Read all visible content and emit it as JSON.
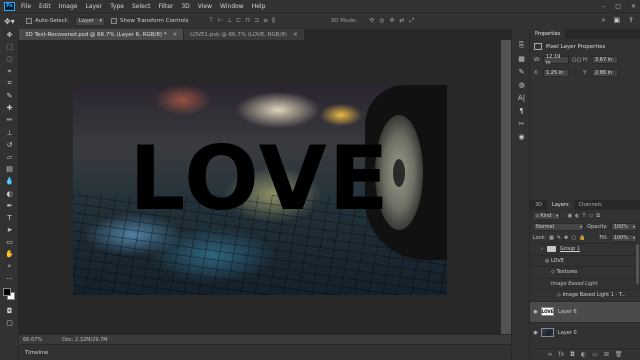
{
  "menu": {
    "logo": "Ps",
    "items": [
      "File",
      "Edit",
      "Image",
      "Layer",
      "Type",
      "Select",
      "Filter",
      "3D",
      "View",
      "Window",
      "Help"
    ],
    "window_controls": [
      "–",
      "□",
      "✕"
    ]
  },
  "options_bar": {
    "tool_icon": "move-icon",
    "auto_select_label": "Auto-Select:",
    "auto_select_value": "Layer",
    "show_transform_label": "Show Transform Controls",
    "mode_3d_label": "3D Mode:"
  },
  "tabs": [
    {
      "label": "3D Text-Recovered.psd @ 66.7% (Layer 6, RGB/8) *",
      "active": true
    },
    {
      "label": "LOVE1.psb @ 66.7% (LOVE, RGB/8)",
      "active": false
    }
  ],
  "canvas": {
    "artwork_text": "LOVE"
  },
  "status": {
    "zoom": "66.67%",
    "doc_info": "Doc: 2.32M/29.7M"
  },
  "timeline_label": "Timeline",
  "properties": {
    "tab_label": "Properties",
    "section_title": "Pixel Layer Properties",
    "w_label": "W:",
    "w_value": "12.19 in",
    "h_label": "H:",
    "h_value": "3.67 in",
    "x_label": "X:",
    "x_value": "1.25 in",
    "y_label": "Y:",
    "y_value": "2.86 in",
    "link_symbol": "GO"
  },
  "layers_panel": {
    "tabs": [
      "3D",
      "Layers",
      "Channels"
    ],
    "active_tab": "Layers",
    "kind_label": "Kind",
    "blend_mode": "Normal",
    "opacity_label": "Opacity:",
    "opacity_value": "100%",
    "lock_label": "Lock:",
    "fill_label": "Fill:",
    "fill_value": "100%",
    "layers": {
      "group1": "Group 1",
      "love": "LOVE",
      "textures": "Textures",
      "ibl": "Image Based Light",
      "ibl1": "Image Based Light 1 - T...",
      "layer6": "Layer 6",
      "layer0": "Layer 0"
    },
    "thumb_text": "LOVE"
  }
}
